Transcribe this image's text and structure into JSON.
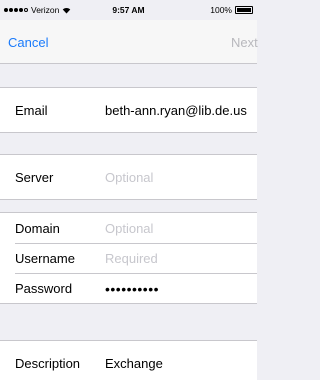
{
  "status_bar": {
    "carrier": "Verizon",
    "time": "9:57 AM",
    "battery": "100%",
    "battery_level": 1.0,
    "signal_bars": 4,
    "signal_total": 5,
    "wifi_icon": "wifi-icon",
    "battery_icon": "battery-icon"
  },
  "nav": {
    "cancel_label": "Cancel",
    "next_label": "Next"
  },
  "form": {
    "email": {
      "label": "Email",
      "value": "beth-ann.ryan@lib.de.us"
    },
    "server": {
      "label": "Server",
      "placeholder": "Optional"
    },
    "domain": {
      "label": "Domain",
      "placeholder": "Optional"
    },
    "username": {
      "label": "Username",
      "placeholder": "Required"
    },
    "password": {
      "label": "Password",
      "value": "••••••••••"
    },
    "description": {
      "label": "Description",
      "value": "Exchange"
    }
  },
  "colors": {
    "accent": "#1b7bfb",
    "disabled": "#b8b8bd",
    "placeholder": "#c7c7cd",
    "background": "#efeff4"
  }
}
